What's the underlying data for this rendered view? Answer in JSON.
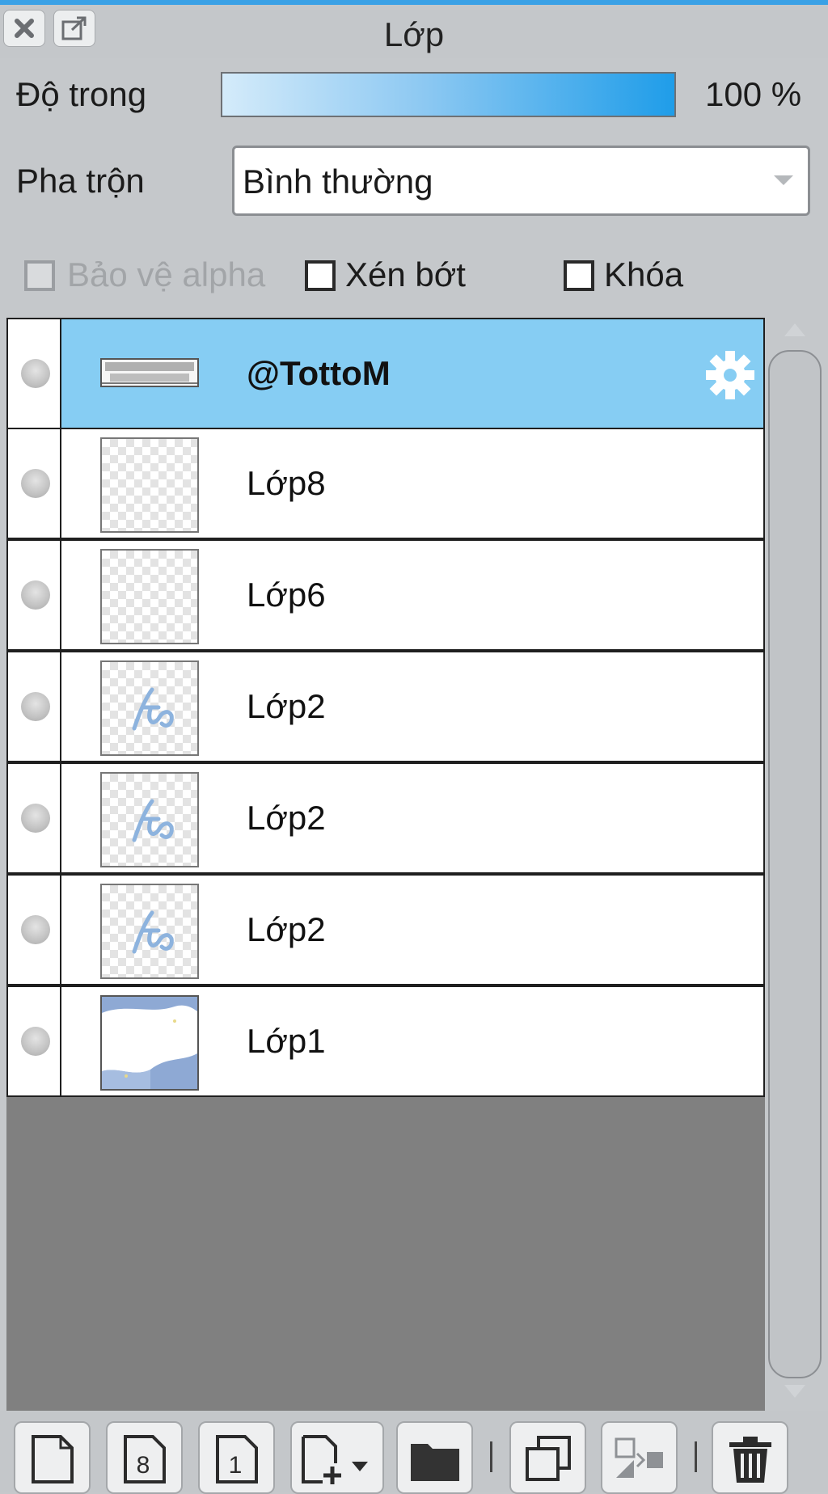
{
  "window": {
    "title": "Lớp",
    "close_icon": "close-icon",
    "popout_icon": "popout-icon"
  },
  "opacity": {
    "label": "Độ trong",
    "value_text": "100 %",
    "value": 100
  },
  "blend": {
    "label": "Pha trộn",
    "value": "Bình thường"
  },
  "options": {
    "alpha_protect": {
      "label": "Bảo vệ alpha",
      "checked": false,
      "disabled": true
    },
    "clip": {
      "label": "Xén bớt",
      "checked": false
    },
    "lock": {
      "label": "Khóa",
      "checked": false
    }
  },
  "colors": {
    "selected_row": "#86cdf3",
    "accent": "#1f9de9"
  },
  "layers": [
    {
      "name": "@TottoM",
      "selected": true,
      "thumb": "text"
    },
    {
      "name": "Lớp8",
      "selected": false,
      "thumb": "empty"
    },
    {
      "name": "Lớp6",
      "selected": false,
      "thumb": "empty"
    },
    {
      "name": "Lớp2",
      "selected": false,
      "thumb": "script"
    },
    {
      "name": "Lớp2",
      "selected": false,
      "thumb": "script"
    },
    {
      "name": "Lớp2",
      "selected": false,
      "thumb": "script"
    },
    {
      "name": "Lớp1",
      "selected": false,
      "thumb": "image"
    }
  ],
  "toolbar": {
    "add_8bit_label": "8",
    "add_1bit_label": "1"
  }
}
